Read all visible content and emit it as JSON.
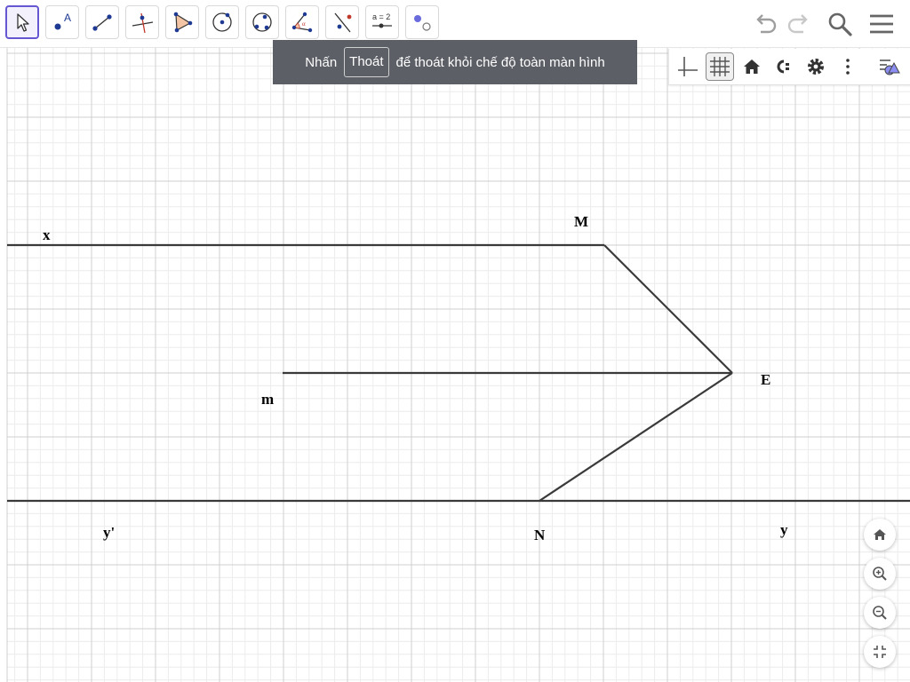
{
  "tooltip": {
    "before": "Nhấn",
    "button": "Thoát",
    "after": "để thoát khỏi chế độ toàn màn hình"
  },
  "toolbar": {
    "tools": [
      {
        "name": "move-tool",
        "icon": "arrow-cursor-icon"
      },
      {
        "name": "point-tool",
        "icon": "point-icon",
        "glyph": "A"
      },
      {
        "name": "segment-tool",
        "icon": "segment-icon"
      },
      {
        "name": "perpendicular-line-tool",
        "icon": "perpendicular-icon"
      },
      {
        "name": "polygon-tool",
        "icon": "polygon-icon"
      },
      {
        "name": "circle-center-point-tool",
        "icon": "circle-center-icon"
      },
      {
        "name": "circle-three-points-tool",
        "icon": "circle-3points-icon"
      },
      {
        "name": "angle-tool",
        "icon": "angle-icon",
        "glyph": "α"
      },
      {
        "name": "reflect-tool",
        "icon": "reflect-icon"
      },
      {
        "name": "slider-tool",
        "icon": "slider-icon",
        "glyph": "a = 2"
      },
      {
        "name": "show-hide-tool",
        "icon": "show-hide-icon"
      }
    ],
    "right": [
      "undo-icon",
      "redo-icon",
      "search-icon",
      "menu-icon"
    ]
  },
  "stylebar": [
    "axes-icon",
    "grid-icon",
    "home-icon",
    "label-style-icon",
    "gear-icon",
    "more-vertical-icon",
    "algebra-toggle-icon"
  ],
  "zoom": [
    "home-icon",
    "zoom-in-icon",
    "zoom-out-icon",
    "exit-fullscreen-icon"
  ],
  "labels": {
    "x": "x",
    "M": "M",
    "m": "m",
    "E": "E",
    "y_prime": "y'",
    "N": "N",
    "y": "y"
  },
  "colors": {
    "accent": "#6557d2",
    "point_blue": "#1f3a93",
    "point_red": "#c0392b",
    "line": "#3a3a3a",
    "grid_minor": "#ececec",
    "grid_major": "#cfcfcf"
  }
}
